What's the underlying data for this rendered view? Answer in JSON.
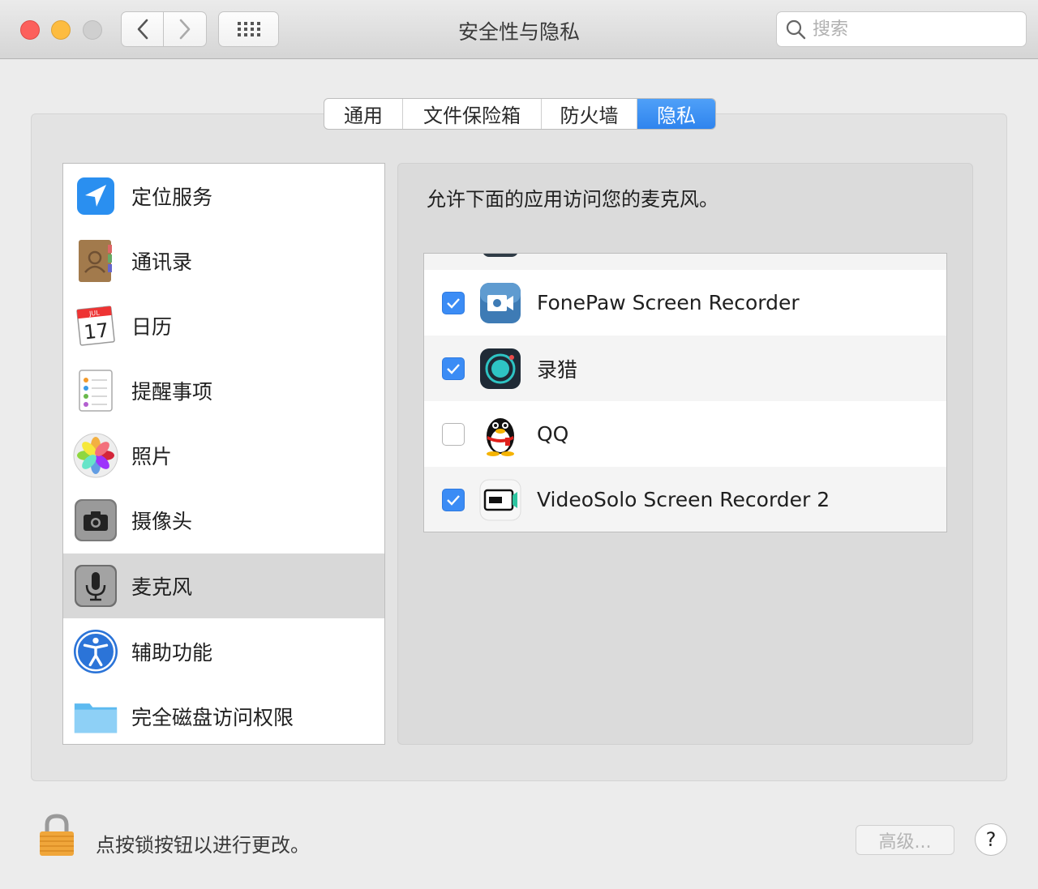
{
  "window": {
    "title": "安全性与隐私"
  },
  "search": {
    "placeholder": "搜索"
  },
  "tabs": [
    {
      "label": "通用",
      "active": false
    },
    {
      "label": "文件保险箱",
      "active": false
    },
    {
      "label": "防火墙",
      "active": false
    },
    {
      "label": "隐私",
      "active": true
    }
  ],
  "sidebar": {
    "items": [
      {
        "label": "定位服务",
        "icon": "location-arrow-icon"
      },
      {
        "label": "通讯录",
        "icon": "contacts-book-icon"
      },
      {
        "label": "日历",
        "icon": "calendar-icon",
        "month": "JUL",
        "day": "17"
      },
      {
        "label": "提醒事项",
        "icon": "reminders-icon"
      },
      {
        "label": "照片",
        "icon": "photos-icon"
      },
      {
        "label": "摄像头",
        "icon": "camera-icon"
      },
      {
        "label": "麦克风",
        "icon": "microphone-icon",
        "selected": true
      },
      {
        "label": "辅助功能",
        "icon": "accessibility-icon"
      },
      {
        "label": "完全磁盘访问权限",
        "icon": "folder-icon"
      }
    ]
  },
  "main": {
    "description": "允许下面的应用访问您的麦克风。",
    "apps": [
      {
        "name": "FonePaw Screen Recorder",
        "checked": true,
        "icon": "fonepaw-icon"
      },
      {
        "name": "录猎",
        "checked": true,
        "icon": "rec-icon"
      },
      {
        "name": "QQ",
        "checked": false,
        "icon": "qq-penguin-icon"
      },
      {
        "name": "VideoSolo Screen Recorder 2",
        "checked": true,
        "icon": "videosolo-icon"
      }
    ]
  },
  "footer": {
    "lock_text": "点按锁按钮以进行更改。",
    "advanced_label": "高级...",
    "help_label": "?"
  },
  "colors": {
    "accent": "#2f84ee",
    "checkbox": "#3b8cf5"
  }
}
